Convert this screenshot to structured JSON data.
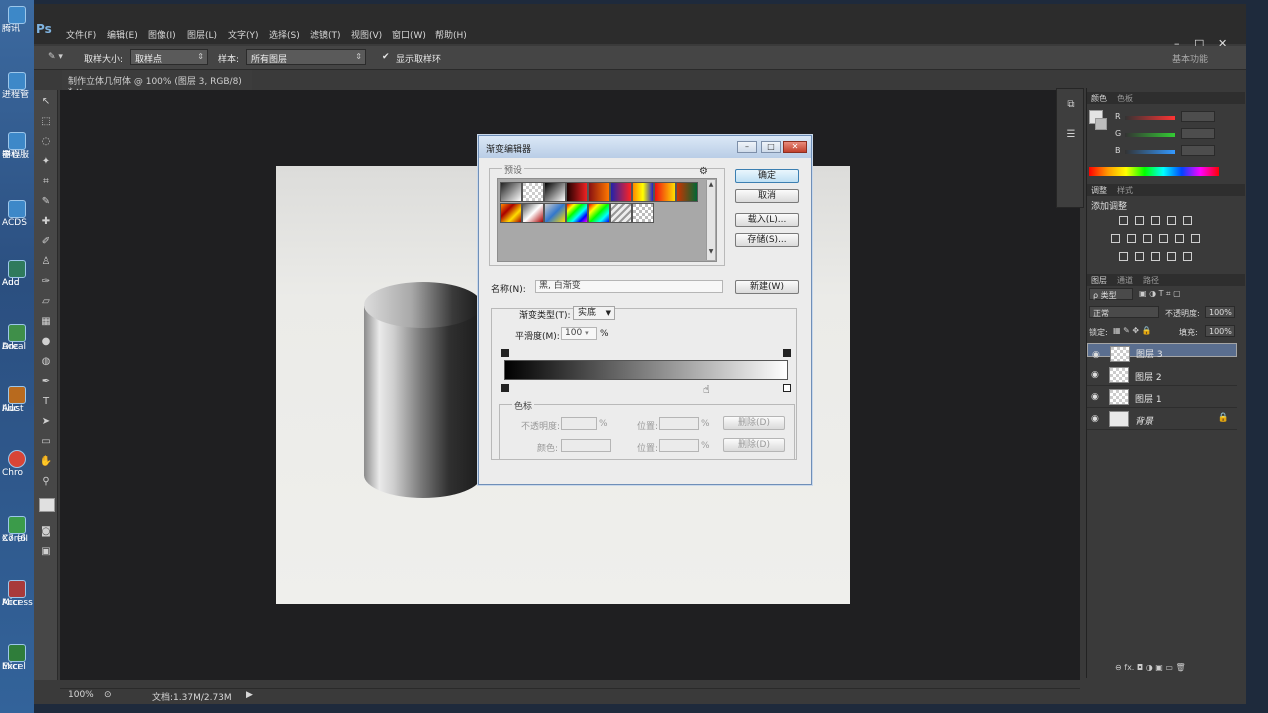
{
  "desktop": {
    "icons": [
      {
        "label": "腾讯",
        "icon": "qq-icon"
      },
      {
        "label": "进程管",
        "icon": "process-manager-icon"
      },
      {
        "label": "中心服",
        "icon": "server-icon"
      },
      {
        "label": "器程",
        "icon": "server-icon"
      },
      {
        "label": "ACDS",
        "icon": "acdsee-icon"
      },
      {
        "label": "Adc",
        "icon": "adobe-icon"
      },
      {
        "label": "Aud",
        "icon": "audition-icon"
      },
      {
        "label": "Adc",
        "icon": "adobe-icon"
      },
      {
        "label": "Dreal",
        "icon": "dreamweaver-icon"
      },
      {
        "label": "Adc",
        "icon": "adobe-icon"
      },
      {
        "label": "Illust",
        "icon": "illustrator-icon"
      },
      {
        "label": "Chro",
        "icon": "chrome-icon"
      },
      {
        "label": "CorelI",
        "icon": "coreldraw-icon"
      },
      {
        "label": "X7 (6",
        "icon": "coreldraw-icon"
      },
      {
        "label": "Micr",
        "icon": "access-icon"
      },
      {
        "label": "Access",
        "icon": "access-icon"
      },
      {
        "label": "Micr",
        "icon": "excel-icon"
      },
      {
        "label": "Excel",
        "icon": "excel-icon"
      }
    ]
  },
  "app": {
    "logo": "Ps",
    "menu": [
      "文件(F)",
      "编辑(E)",
      "图像(I)",
      "图层(L)",
      "文字(Y)",
      "选择(S)",
      "滤镜(T)",
      "视图(V)",
      "窗口(W)",
      "帮助(H)"
    ],
    "window_controls": [
      "–",
      "□",
      "✕"
    ]
  },
  "options_bar": {
    "sample_size_label": "取样大小:",
    "sample_size_value": "取样点",
    "sample_label": "样本:",
    "sample_value": "所有图层",
    "show_ring_label": "显示取样环",
    "show_ring_checked": true
  },
  "document": {
    "tab_title": "制作立体几何体 @ 100% (图层 3, RGB/8) *",
    "zoom": "100%",
    "doc_size": "文档:1.37M/2.73M"
  },
  "workspace": {
    "label": "基本功能"
  },
  "color_panel": {
    "tabs": [
      "颜色",
      "色板"
    ],
    "channels": [
      "R",
      "G",
      "B"
    ]
  },
  "adjustments_panel": {
    "tabs": [
      "调整",
      "样式"
    ],
    "title": "添加调整"
  },
  "layers_panel": {
    "tabs": [
      "图层",
      "通道",
      "路径"
    ],
    "filter_label": "ρ 类型",
    "blend_mode": "正常",
    "opacity_label": "不透明度:",
    "opacity_value": "100%",
    "lock_label": "锁定:",
    "fill_label": "填充:",
    "fill_value": "100%",
    "layers": [
      {
        "name": "图层 3",
        "selected": true,
        "thumb": "checker"
      },
      {
        "name": "图层 2",
        "selected": false,
        "thumb": "checker"
      },
      {
        "name": "图层 1",
        "selected": false,
        "thumb": "checker"
      },
      {
        "name": "背景",
        "selected": false,
        "thumb": "white",
        "locked": true
      }
    ],
    "footer": "⊖ fx. ◘ ◑ ▣ ▭ 🗑"
  },
  "gradient_editor": {
    "title": "渐变编辑器",
    "presets_label": "预设",
    "buttons": {
      "ok": "确定",
      "cancel": "取消",
      "load": "载入(L)...",
      "save": "存储(S)...",
      "new": "新建(W)"
    },
    "name_label": "名称(N):",
    "name_value": "黑, 白渐变",
    "type_label": "渐变类型(T):",
    "type_value": "实底",
    "smoothness_label": "平滑度(M):",
    "smoothness_value": "100",
    "percent": "%",
    "stops_group": "色标",
    "stop_opacity_label": "不透明度:",
    "stop_color_label": "颜色:",
    "location_label": "位置:",
    "delete_label": "删除(D)",
    "gradient": {
      "start_color": "#000000",
      "end_color": "#ffffff",
      "midpoint_fraction": 0.5
    }
  }
}
